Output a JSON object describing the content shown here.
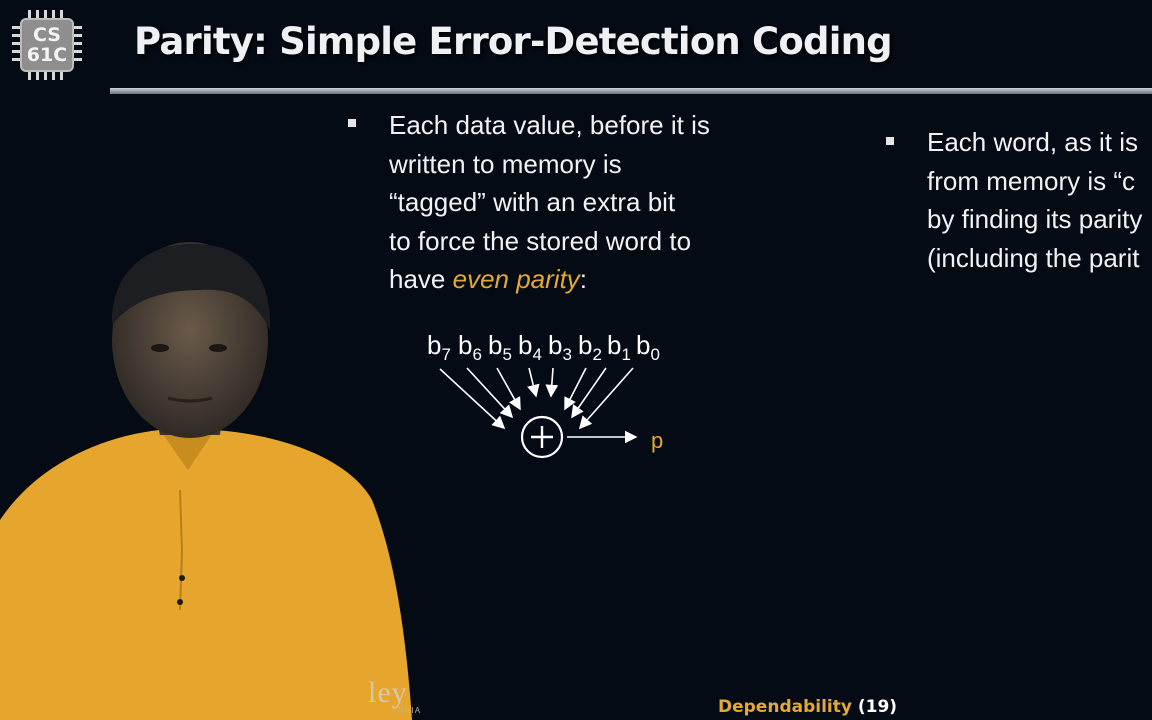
{
  "logo": {
    "line1": "CS",
    "line2": "61C"
  },
  "slide_title": "Parity: Simple Error-Detection Coding",
  "left_bullet": {
    "lines": [
      "Each data value, before it is",
      "written to memory is",
      "“tagged” with an extra bit",
      "to force the stored word to"
    ],
    "last_line_prefix": "have ",
    "last_line_emphasis": "even parity",
    "last_line_suffix": ":"
  },
  "right_bullet": {
    "lines": [
      "Each word, as it is",
      "from memory is “c",
      "by finding its parity",
      "(including the parit"
    ]
  },
  "parity_diagram": {
    "bits": [
      {
        "letter": "b",
        "index": "7"
      },
      {
        "letter": "b",
        "index": "6"
      },
      {
        "letter": "b",
        "index": "5"
      },
      {
        "letter": "b",
        "index": "4"
      },
      {
        "letter": "b",
        "index": "3"
      },
      {
        "letter": "b",
        "index": "2"
      },
      {
        "letter": "b",
        "index": "1"
      },
      {
        "letter": "b",
        "index": "0"
      }
    ],
    "operator_icon": "xor-circle-plus-icon",
    "output_label": "p"
  },
  "watermark": {
    "text": "ley",
    "subtext": "RNIA"
  },
  "footer": {
    "topic": "Dependability",
    "page": "(19)"
  },
  "colors": {
    "background": "#040b14",
    "accent": "#e4a837",
    "text": "#ffffff",
    "shirt": "#e6a52c"
  }
}
